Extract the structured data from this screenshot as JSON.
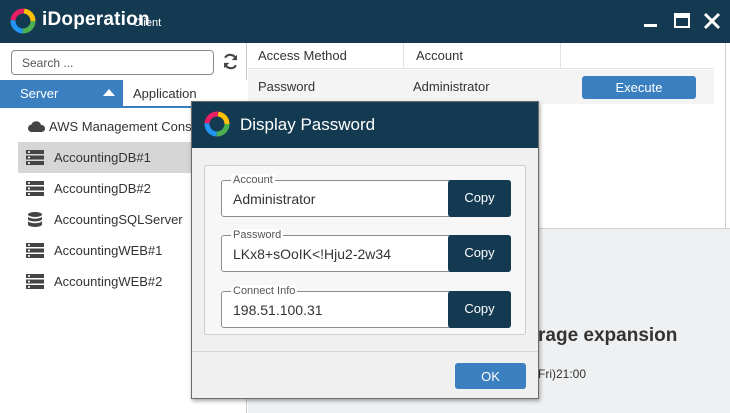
{
  "app": {
    "title": "iDoperation",
    "subtitle": "Client"
  },
  "window_controls": {
    "minimize": "minimize-icon",
    "maximize": "maximize-icon",
    "close": "close-icon"
  },
  "sidebar": {
    "search_placeholder": "Search ...",
    "tabs": [
      {
        "label": "Server",
        "active": true
      },
      {
        "label": "Application",
        "active": false
      }
    ],
    "items": [
      {
        "label": "AWS Management Console",
        "icon": "cloud-icon",
        "selected": false
      },
      {
        "label": "AccountingDB#1",
        "icon": "server-icon",
        "selected": true
      },
      {
        "label": "AccountingDB#2",
        "icon": "server-icon",
        "selected": false
      },
      {
        "label": "AccountingSQLServer",
        "icon": "database-icon",
        "selected": false
      },
      {
        "label": "AccountingWEB#1",
        "icon": "server-icon",
        "selected": false
      },
      {
        "label": "AccountingWEB#2",
        "icon": "server-icon",
        "selected": false
      }
    ]
  },
  "grid": {
    "headers": [
      "Access Method",
      "Account"
    ],
    "row": {
      "access_method": "Password",
      "account": "Administrator",
      "action": "Execute"
    }
  },
  "detail": {
    "title_fragment": "rage expansion",
    "date_fragment": "Fri)21:00"
  },
  "dialog": {
    "title": "Display Password",
    "fields": [
      {
        "label": "Account",
        "value": "Administrator",
        "button": "Copy"
      },
      {
        "label": "Password",
        "value": "LKx8+sOoIK<!Hju2-2w34",
        "button": "Copy"
      },
      {
        "label": "Connect Info",
        "value": "198.51.100.31",
        "button": "Copy"
      }
    ],
    "ok_label": "OK"
  },
  "colors": {
    "titlebar": "#143a52",
    "accent": "#3a7fbf",
    "copy_button": "#143a52",
    "selected_row": "#d6d6d6"
  }
}
